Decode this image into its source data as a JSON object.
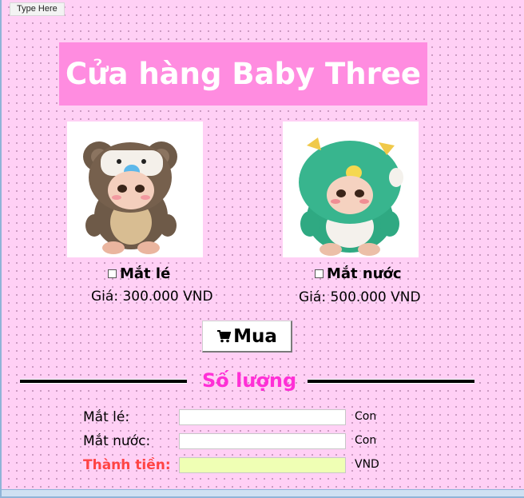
{
  "designer": {
    "menu_hint": "Type Here"
  },
  "header": {
    "title": "Cửa hàng Baby Three"
  },
  "products": [
    {
      "name": "Mắt lé",
      "price": "Giá: 300.000 VND",
      "image": "brown-bear-plush-doll",
      "checked": false
    },
    {
      "name": "Mắt nước",
      "price": "Giá: 500.000 VND",
      "image": "green-dinosaur-plush-doll",
      "checked": false
    }
  ],
  "buy_button": {
    "label": "Mua",
    "icon": "cart-icon"
  },
  "quantity": {
    "section_title": "Số lượng",
    "rows": [
      {
        "label": "Mắt lé:",
        "value": "",
        "unit": "Con"
      },
      {
        "label": "Mắt nước:",
        "value": "",
        "unit": "Con"
      }
    ],
    "total": {
      "label": "Thành tiền:",
      "value": "",
      "unit": "VND"
    }
  },
  "colors": {
    "form_background": "#ffd0f5",
    "title_background": "#ff8ce0",
    "section_title": "#ff2fd6",
    "total_label": "#ff4444",
    "total_field": "#efffb4"
  }
}
